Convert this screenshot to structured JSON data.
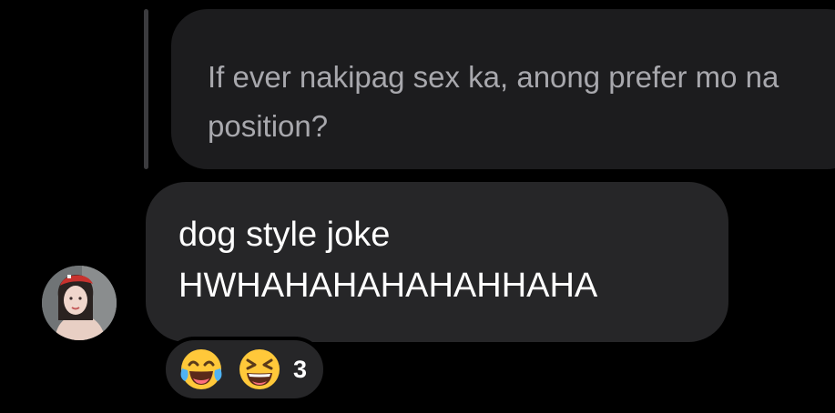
{
  "quoted_message": {
    "text": "If ever nakipag sex ka, anong prefer mo na position?"
  },
  "message": {
    "lines": [
      "dog style joke",
      "HWHAHAHAHAHAHHAHA"
    ]
  },
  "sender": {
    "avatar_icon": "profile-photo-avatar"
  },
  "reactions": {
    "icons": [
      "face-with-tears-of-joy-icon",
      "grinning-squinting-face-icon"
    ],
    "count": "3"
  },
  "colors": {
    "background": "#000000",
    "quoted_bubble": "#1c1c1e",
    "quoted_text": "#a8a8ad",
    "message_bubble": "#262628",
    "message_text": "#ffffff",
    "emoji_yellow": "#ffc83a",
    "emoji_blue_tears": "#4fb3f4"
  }
}
